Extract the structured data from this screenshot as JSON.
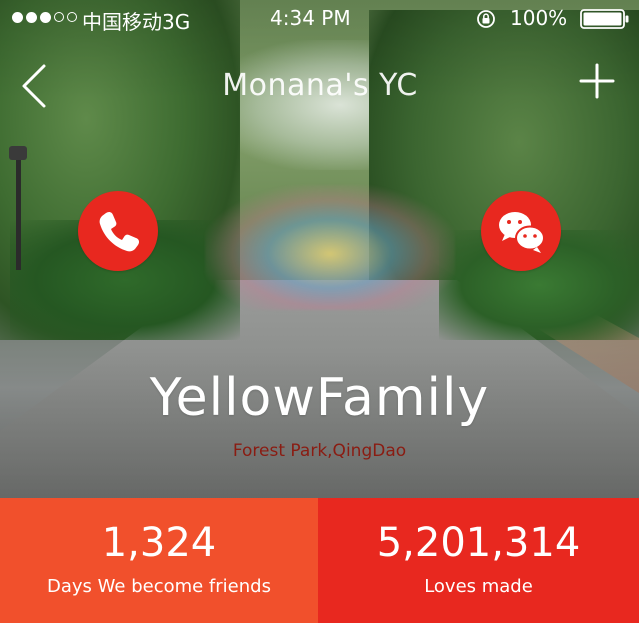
{
  "status_bar": {
    "carrier": "中国移动3G",
    "time": "4:34 PM",
    "battery": "100%",
    "icons": [
      "signal-dots",
      "rotation-lock-icon",
      "battery-icon"
    ]
  },
  "nav": {
    "title": "Monana's YC",
    "back_icon": "chevron-left-icon",
    "add_icon": "plus-icon"
  },
  "actions": {
    "call_icon": "phone-icon",
    "wechat_icon": "wechat-icon",
    "accent_color": "#e8281f"
  },
  "group": {
    "name": "YellowFamily",
    "location": "Forest Park,QingDao",
    "location_color": "#8a1c12"
  },
  "stats": {
    "days": {
      "value": "1,324",
      "label": "Days We become friends",
      "color": "#f1502c"
    },
    "loves": {
      "value": "5,201,314",
      "label": "Loves made",
      "color": "#e8281f"
    }
  }
}
